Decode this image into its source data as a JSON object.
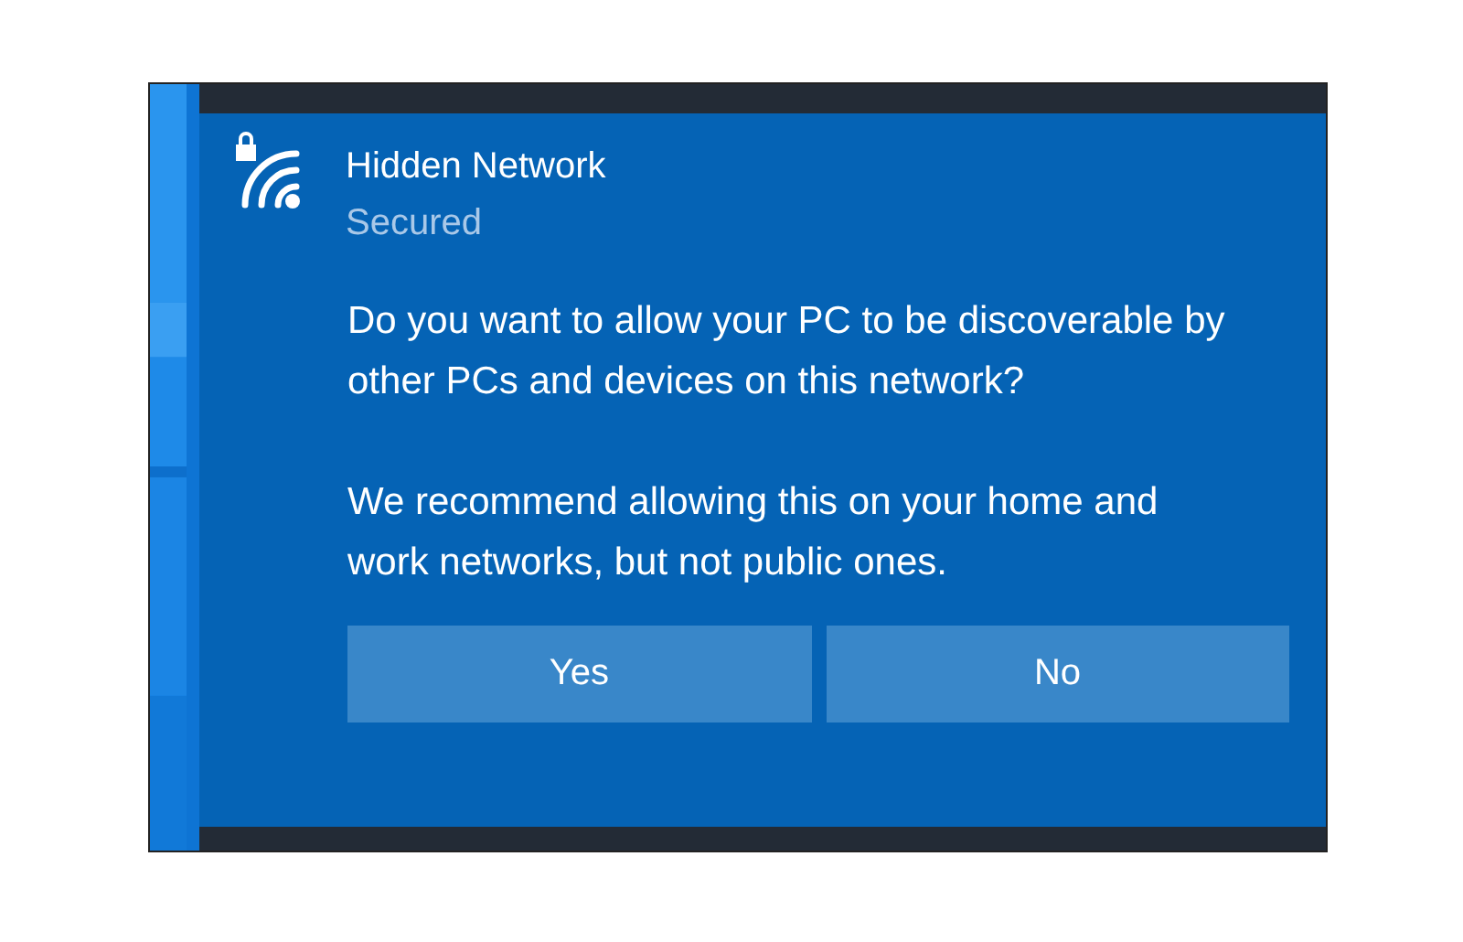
{
  "network": {
    "name": "Hidden Network",
    "status": "Secured",
    "secured": true
  },
  "message": "Do you want to allow your PC to be discoverable by other PCs and devices on this network?",
  "recommendation": "We recommend allowing this on your home and work networks, but not public ones.",
  "buttons": [
    "Yes",
    "No"
  ]
}
